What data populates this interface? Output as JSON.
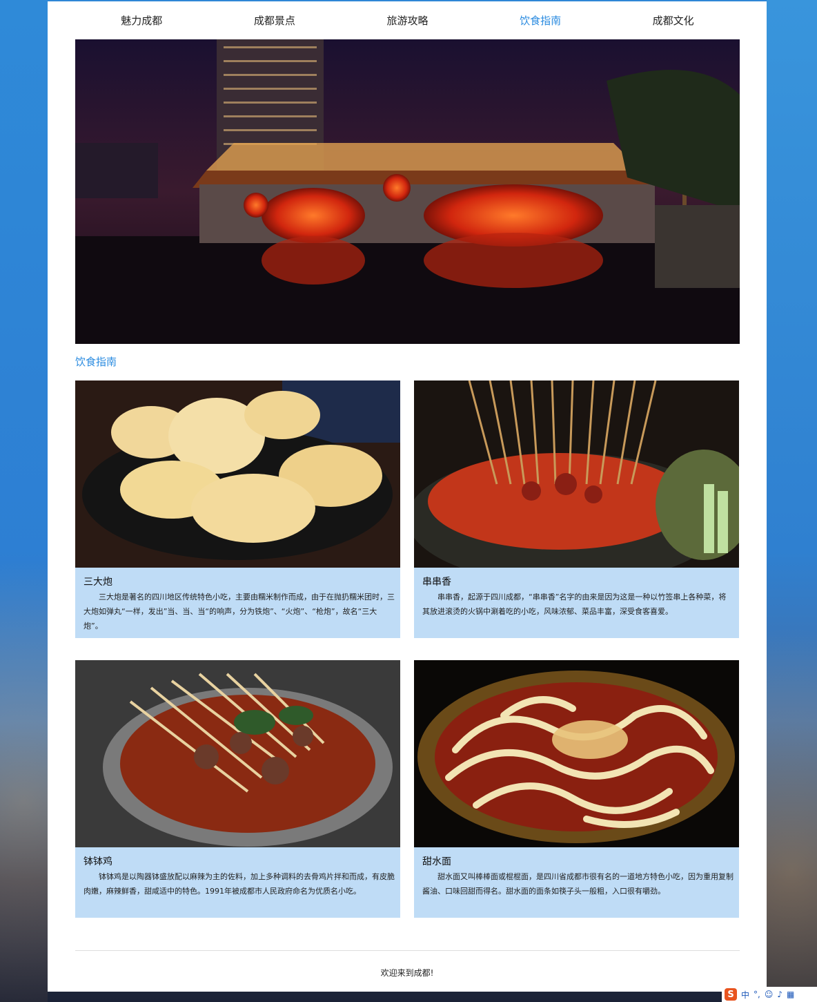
{
  "nav": {
    "items": [
      {
        "label": "魅力成都",
        "active": false
      },
      {
        "label": "成都景点",
        "active": false
      },
      {
        "label": "旅游攻略",
        "active": false
      },
      {
        "label": "饮食指南",
        "active": true
      },
      {
        "label": "成都文化",
        "active": false
      }
    ]
  },
  "banner": {
    "icon": "anshun-bridge-night-photo"
  },
  "section": {
    "title": "饮食指南"
  },
  "cards": [
    {
      "title": "三大炮",
      "text": "三大炮是著名的四川地区传统特色小吃，主要由糯米制作而成，由于在抛扔糯米团时，三大炮如弹丸“一样，发出”当、当、当“的响声，分为铁炮”、“火炮”、“枪炮”，故名“三大炮”。"
    },
    {
      "title": "串串香",
      "text": "串串香，起源于四川成都，“串串香”名字的由来是因为这是一种以竹签串上各种菜，将其放进滚烫的火锅中涮着吃的小吃，风味浓郁、菜品丰富，深受食客喜爱。"
    },
    {
      "title": "钵钵鸡",
      "text": "钵钵鸡是以陶器钵盛放配以麻辣为主的佐料，加上多种调料的去骨鸡片拌和而成，有皮脆肉嫩，麻辣鲜香，甜咸适中的特色。1991年被成都市人民政府命名为优质名小吃。"
    },
    {
      "title": "甜水面",
      "text": "甜水面又叫棒棒面或棍棍面，是四川省成都市很有名的一道地方特色小吃，因为重用复制酱油、口味回甜而得名。甜水面的面条如筷子头一般粗，入口很有嚼劲。"
    }
  ],
  "footer": {
    "text": "欢迎来到成都!"
  },
  "ime": {
    "logo": "S",
    "mode": "中"
  },
  "colors": {
    "accent": "#2a8be0",
    "card_bg": "#bfdcf6"
  }
}
